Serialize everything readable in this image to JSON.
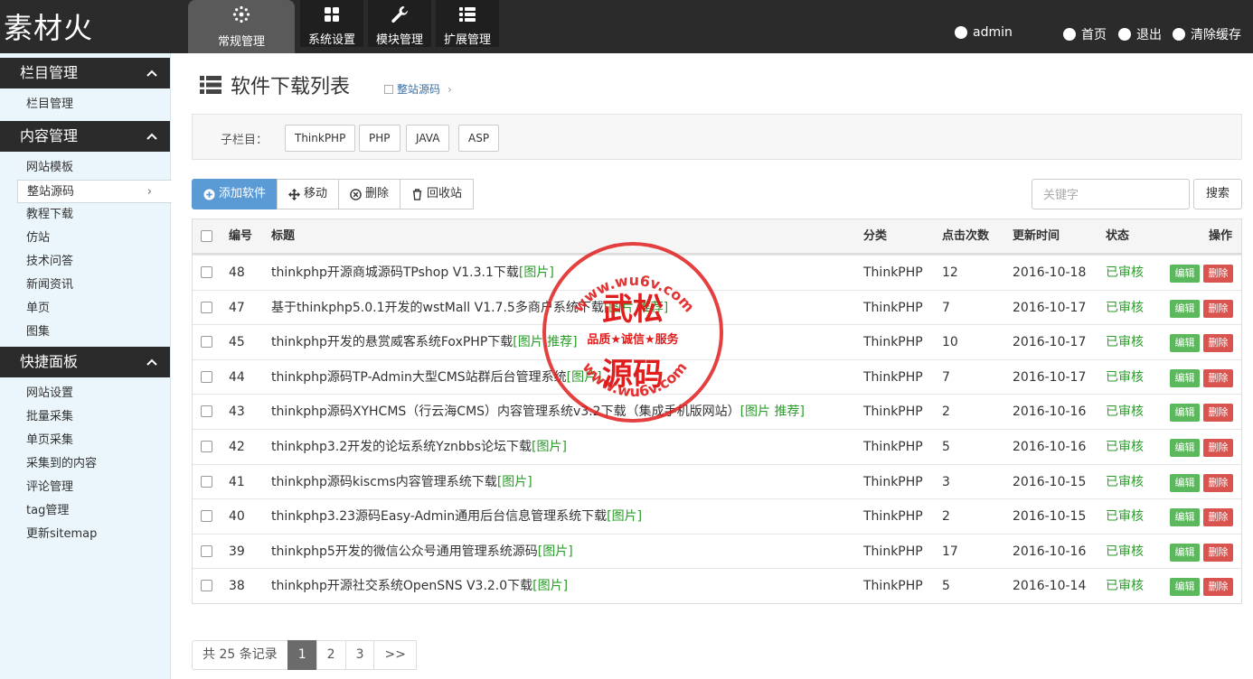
{
  "app": {
    "logo": "素材火"
  },
  "nav_tabs": [
    {
      "label": "常规管理",
      "icon": "gear-flower-icon",
      "active": true
    },
    {
      "label": "系统设置",
      "icon": "grid-icon",
      "active": false
    },
    {
      "label": "模块管理",
      "icon": "wrench-icon",
      "active": false
    },
    {
      "label": "扩展管理",
      "icon": "list-icon",
      "active": false
    }
  ],
  "topright": {
    "user": "admin",
    "home": "首页",
    "logout": "退出",
    "clear_cache": "清除缓存"
  },
  "sidebar": {
    "sections": [
      {
        "title": "栏目管理",
        "items": [
          "栏目管理"
        ]
      },
      {
        "title": "内容管理",
        "items": [
          "网站模板",
          "整站源码",
          "教程下载",
          "仿站",
          "技术问答",
          "新闻资讯",
          "单页",
          "图集"
        ]
      },
      {
        "title": "快捷面板",
        "items": [
          "网站设置",
          "批量采集",
          "单页采集",
          "采集到的内容",
          "评论管理",
          "tag管理",
          "更新sitemap"
        ]
      }
    ],
    "active_item": "整站源码"
  },
  "main": {
    "title": "软件下载列表",
    "breadcrumb": "整站源码",
    "subcat_label": "子栏目：",
    "subcats": [
      "ThinkPHP",
      "PHP",
      "JAVA",
      "ASP"
    ],
    "toolbar": {
      "add": "添加软件",
      "move": "移动",
      "delete": "删除",
      "recycle": "回收站"
    },
    "search": {
      "placeholder": "关键字",
      "button": "搜索"
    },
    "table": {
      "headers": {
        "id": "编号",
        "title": "标题",
        "category": "分类",
        "clicks": "点击次数",
        "updated": "更新时间",
        "status": "状态",
        "ops": "操作"
      },
      "rows": [
        {
          "id": "48",
          "title": "thinkphp开源商城源码TPshop V1.3.1下载",
          "tag": "[图片]",
          "category": "ThinkPHP",
          "clicks": "12",
          "updated": "2016-10-18",
          "status": "已审核"
        },
        {
          "id": "47",
          "title": "基于thinkphp5.0.1开发的wstMall V1.7.5多商户系统下载",
          "tag": "[图片 推荐]",
          "category": "ThinkPHP",
          "clicks": "7",
          "updated": "2016-10-17",
          "status": "已审核"
        },
        {
          "id": "45",
          "title": "thinkphp开发的悬赏威客系统FoxPHP下载",
          "tag": "[图片 推荐]",
          "category": "ThinkPHP",
          "clicks": "10",
          "updated": "2016-10-17",
          "status": "已审核"
        },
        {
          "id": "44",
          "title": "thinkphp源码TP-Admin大型CMS站群后台管理系统",
          "tag": "[图片]",
          "category": "ThinkPHP",
          "clicks": "7",
          "updated": "2016-10-17",
          "status": "已审核"
        },
        {
          "id": "43",
          "title": "thinkphp源码XYHCMS（行云海CMS）内容管理系统v3.2下载（集成手机版网站）",
          "tag": "[图片 推荐]",
          "category": "ThinkPHP",
          "clicks": "2",
          "updated": "2016-10-16",
          "status": "已审核"
        },
        {
          "id": "42",
          "title": "thinkphp3.2开发的论坛系统Yznbbs论坛下载",
          "tag": "[图片]",
          "category": "ThinkPHP",
          "clicks": "5",
          "updated": "2016-10-16",
          "status": "已审核"
        },
        {
          "id": "41",
          "title": "thinkphp源码kiscms内容管理系统下载",
          "tag": "[图片]",
          "category": "ThinkPHP",
          "clicks": "3",
          "updated": "2016-10-15",
          "status": "已审核"
        },
        {
          "id": "40",
          "title": "thinkphp3.23源码Easy-Admin通用后台信息管理系统下载",
          "tag": "[图片]",
          "category": "ThinkPHP",
          "clicks": "2",
          "updated": "2016-10-15",
          "status": "已审核"
        },
        {
          "id": "39",
          "title": "thinkphp5开发的微信公众号通用管理系统源码",
          "tag": "[图片]",
          "category": "ThinkPHP",
          "clicks": "17",
          "updated": "2016-10-16",
          "status": "已审核"
        },
        {
          "id": "38",
          "title": "thinkphp开源社交系统OpenSNS V3.2.0下载",
          "tag": "[图片]",
          "category": "ThinkPHP",
          "clicks": "5",
          "updated": "2016-10-14",
          "status": "已审核"
        }
      ],
      "edit_label": "编辑",
      "delete_label": "删除"
    },
    "pager": {
      "total": "共 25 条记录",
      "pages": [
        "1",
        "2",
        "3"
      ],
      "next": ">>",
      "current": "1"
    }
  },
  "watermark": {
    "top_text": "www.wu6v.com",
    "main1": "武松",
    "middle": "品质★诚信★服务",
    "main2": "源码",
    "bottom_text": "www.wu6v.com",
    "color": "#e01e1e"
  }
}
